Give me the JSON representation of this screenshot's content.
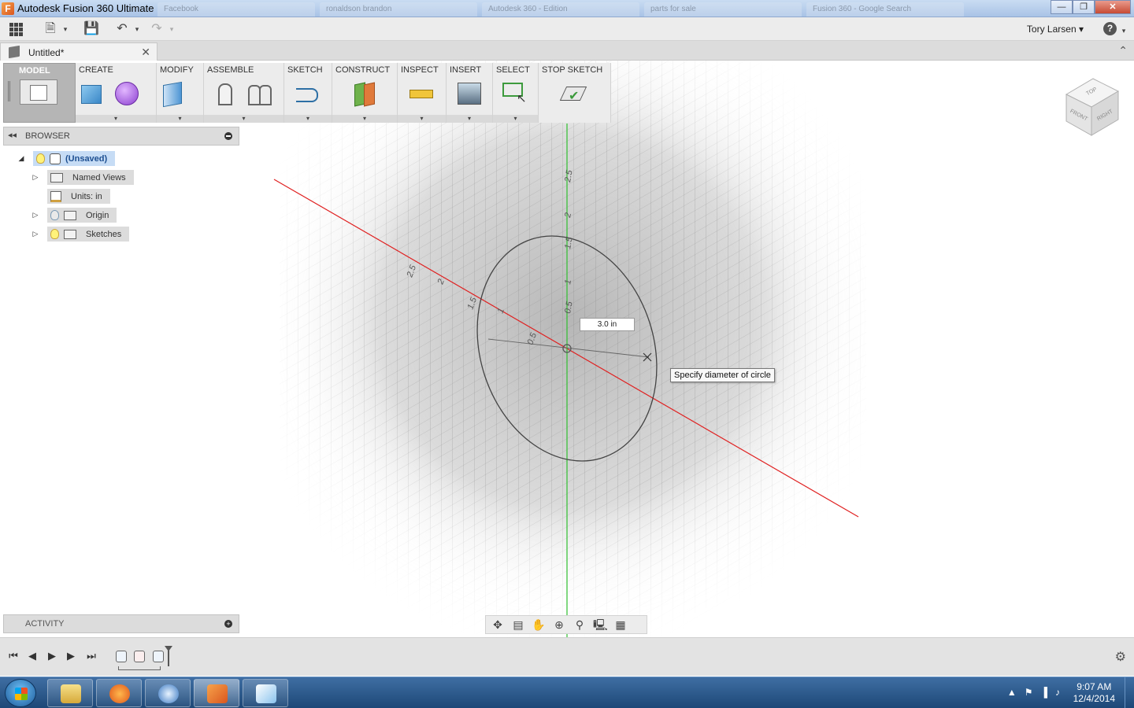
{
  "window": {
    "title": "Autodesk Fusion 360 Ultimate",
    "app_icon_letter": "F",
    "minimize": "—",
    "maximize": "❐",
    "close": "✕"
  },
  "background_tabs": [
    "Facebook",
    "ronaldson brandon",
    "Autodesk 360 - Edition",
    "parts for sale",
    "Fusion 360 - Google Search"
  ],
  "app_toolbar": {
    "user_name": "Tory Larsen",
    "user_chevron": "▾",
    "help_label": "?"
  },
  "document_tab": {
    "title": "Untitled*",
    "close": "✕"
  },
  "ribbon": {
    "workspace_label": "MODEL",
    "groups": [
      {
        "label": "CREATE"
      },
      {
        "label": "MODIFY"
      },
      {
        "label": "ASSEMBLE"
      },
      {
        "label": "SKETCH"
      },
      {
        "label": "CONSTRUCT"
      },
      {
        "label": "INSPECT"
      },
      {
        "label": "INSERT"
      },
      {
        "label": "SELECT"
      },
      {
        "label": "STOP SKETCH"
      }
    ],
    "dropdown_arrow": "▾"
  },
  "browser": {
    "title": "BROWSER",
    "collapse": "◂◂",
    "tree": [
      {
        "label": "(Unsaved)",
        "arrow": "◢"
      },
      {
        "label": "Named Views",
        "arrow": "▷"
      },
      {
        "label": "Units: in",
        "arrow": ""
      },
      {
        "label": "Origin",
        "arrow": "▷"
      },
      {
        "label": "Sketches",
        "arrow": "▷"
      }
    ]
  },
  "activity": {
    "title": "ACTIVITY",
    "expand": "+"
  },
  "viewport": {
    "dimension_value": "3.0 in",
    "tooltip": "Specify diameter of circle",
    "axis_red": "#e02020",
    "axis_green": "#2fbf2f",
    "vertical_axis_labels": [
      "2.5",
      "2",
      "1.5",
      "1",
      "0.5"
    ],
    "horizontal_axis_labels": [
      "2.5",
      "2",
      "1.5",
      "1",
      "0.5"
    ]
  },
  "view_cube": {
    "top": "TOP",
    "front": "FRONT",
    "right": "RIGHT"
  },
  "timeline": {
    "first": "⏮",
    "prev": "◀",
    "play_step": "▶",
    "play": "▶",
    "last": "⏭",
    "settings": "⚙"
  },
  "taskbar": {
    "time": "9:07 AM",
    "date": "12/4/2014",
    "tray_icons": [
      "▲",
      "⚑",
      "▐",
      "♪"
    ]
  }
}
